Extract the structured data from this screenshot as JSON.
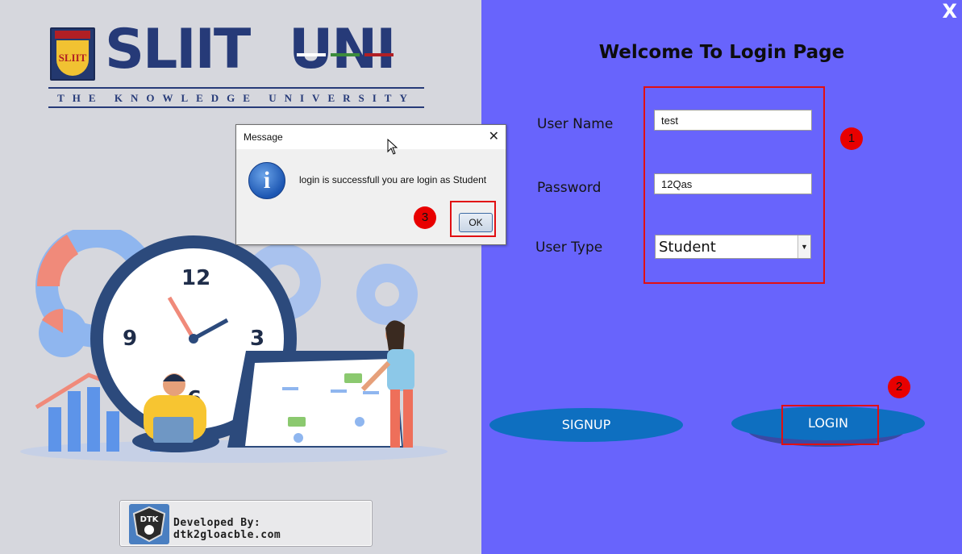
{
  "left_panel": {
    "logo": {
      "name_part1": "SLIIT",
      "name_part2": "UNI",
      "crest_text": "SLIIT",
      "tagline": "THE KNOWLEDGE UNIVERSITY"
    },
    "clock_numbers": [
      "12",
      "3",
      "6",
      "9"
    ],
    "badge": {
      "logo_text": "DTK",
      "text": "Developed By: dtk2gloacble.com"
    }
  },
  "right_panel": {
    "close_label": "X",
    "welcome_title": "Welcome To Login Page",
    "username_label": "User Name",
    "username_value": "test",
    "password_label": "Password",
    "password_value": "12Qas",
    "usertype_label": "User Type",
    "usertype_value": "Student",
    "signup_label": "SIGNUP",
    "login_label": "LOGIN",
    "annotation_markers": [
      "1",
      "2",
      "3"
    ]
  },
  "dialog": {
    "title": "Message",
    "close_label": "✕",
    "message": "login is successfull you are login as Student",
    "icon_glyph": "i",
    "ok_label": "OK"
  },
  "colors": {
    "right_bg": "#6864fc",
    "button_blue": "#0e6fc0",
    "annotation_red": "#e10f12",
    "logo_navy": "#263a78"
  }
}
